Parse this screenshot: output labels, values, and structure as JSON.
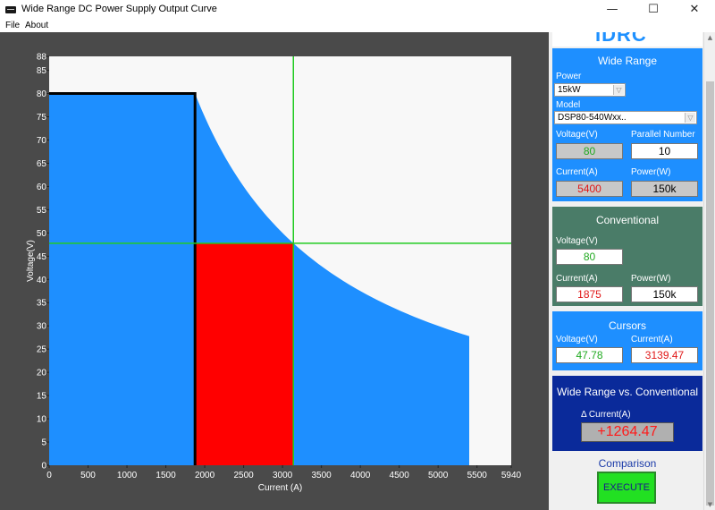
{
  "window": {
    "title": "Wide Range DC Power Supply Output Curve",
    "minimize_glyph": "—",
    "maximize_glyph": "☐",
    "close_glyph": "✕"
  },
  "menu": [
    "File",
    "About"
  ],
  "logo": {
    "text": "IDRC"
  },
  "wide_range": {
    "title": "Wide Range",
    "power_label": "Power",
    "power_value": "15kW",
    "model_label": "Model",
    "model_value": "DSP80-540Wxx..",
    "voltage_label": "Voltage(V)",
    "voltage_value": "80",
    "parallel_label": "Parallel Number",
    "parallel_value": "10",
    "current_label": "Current(A)",
    "current_value": "5400",
    "power_w_label": "Power(W)",
    "power_w_value": "150k"
  },
  "conventional": {
    "title": "Conventional",
    "voltage_label": "Voltage(V)",
    "voltage_value": "80",
    "current_label": "Current(A)",
    "current_value": "1875",
    "power_w_label": "Power(W)",
    "power_w_value": "150k"
  },
  "cursors": {
    "title": "Cursors",
    "voltage_label": "Voltage(V)",
    "voltage_value": "47.78",
    "current_label": "Current(A)",
    "current_value": "3139.47"
  },
  "comparison_box": {
    "title": "Wide Range vs. Conventional",
    "delta_label": "Δ Current(A)",
    "delta_value": "+1264.47"
  },
  "comparison_label": "Comparison",
  "execute_label": "EXECUTE",
  "colors": {
    "accent_blue": "#1e8fff",
    "conventional_green": "#4a7c68",
    "navy": "#0a2a9a",
    "green_text": "#22aa22",
    "red_text": "#e01818",
    "execute_green": "#22e022"
  },
  "chart_data": {
    "type": "area",
    "xlabel": "Current (A)",
    "ylabel": "Voltage(V)",
    "xlim": [
      0,
      5940
    ],
    "ylim": [
      0,
      88
    ],
    "x_ticks": [
      "0",
      "500",
      "1000",
      "1500",
      "2000",
      "2500",
      "3000",
      "3500",
      "4000",
      "4500",
      "5000",
      "5500",
      "5940"
    ],
    "y_ticks": [
      "0",
      "5",
      "10",
      "15",
      "20",
      "25",
      "30",
      "35",
      "40",
      "45",
      "50",
      "55",
      "60",
      "65",
      "70",
      "75",
      "80",
      "85",
      "88"
    ],
    "wide_range_curve": {
      "max_voltage": 80,
      "max_power_w": 150000,
      "max_current": 5400,
      "knee_current": 1875
    },
    "conventional_rect": {
      "voltage": 80,
      "current": 1875
    },
    "cursor": {
      "current": 3139.47,
      "voltage": 47.78
    },
    "grid": false
  }
}
